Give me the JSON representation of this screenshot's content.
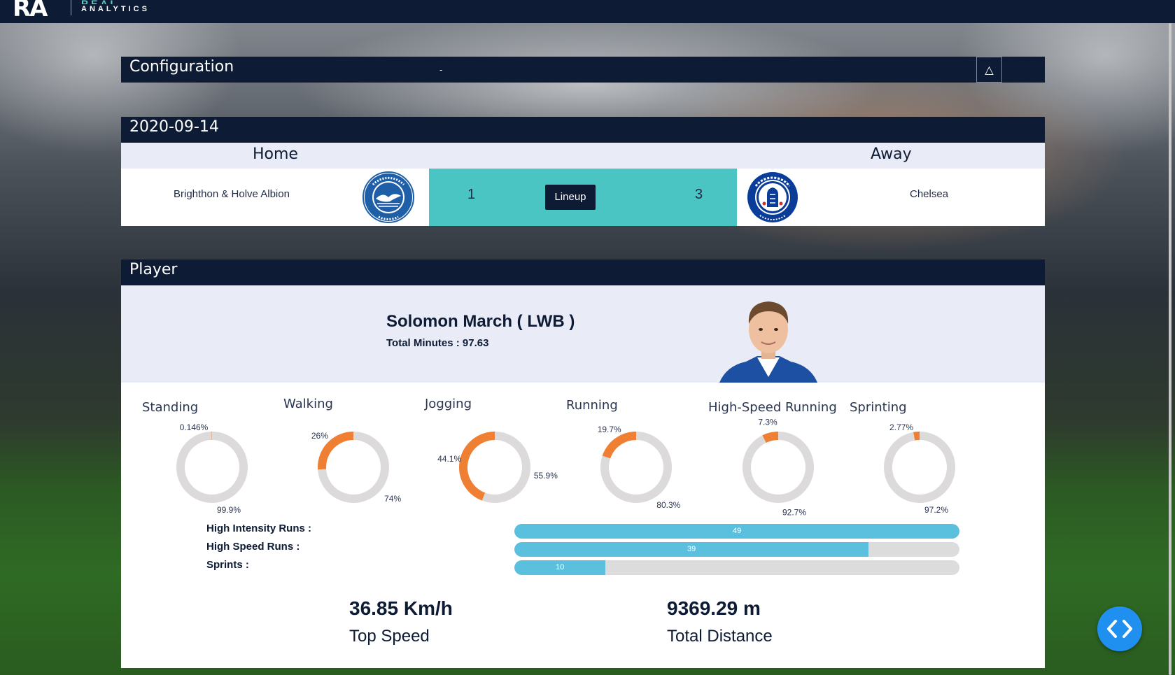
{
  "brand": {
    "mark": "RA",
    "line1": "REAL",
    "line2": "ANALYTICS"
  },
  "config": {
    "title": "Configuration",
    "center_text": "-",
    "collapse_icon": "△"
  },
  "match": {
    "date": "2020-09-14",
    "home_label": "Home",
    "away_label": "Away",
    "home_team": "Brighthon & Holve Albion",
    "away_team": "Chelsea",
    "home_score": "1",
    "away_score": "3",
    "lineup_label": "Lineup",
    "home_crest": "brighton-crest-icon",
    "away_crest": "chelsea-crest-icon"
  },
  "player": {
    "section_title": "Player",
    "name": "Solomon March ( LWB )",
    "minutes": "Total Minutes : 97.63",
    "photo": "player-photo"
  },
  "chart_data": {
    "type": "pie",
    "charts": [
      {
        "title": "Standing",
        "active_pct": 0.146,
        "active_label": "0.146%",
        "rest_label": "99.9%"
      },
      {
        "title": "Walking",
        "active_pct": 26,
        "active_label": "26%",
        "rest_label": "74%"
      },
      {
        "title": "Jogging",
        "active_pct": 44.1,
        "active_label": "44.1%",
        "rest_label": "55.9%"
      },
      {
        "title": "Running",
        "active_pct": 19.7,
        "active_label": "19.7%",
        "rest_label": "80.3%"
      },
      {
        "title": "High-Speed Running",
        "active_pct": 7.3,
        "active_label": "7.3%",
        "rest_label": "92.7%"
      },
      {
        "title": "Sprinting",
        "active_pct": 2.77,
        "active_label": "2.77%",
        "rest_label": "97.2%"
      }
    ],
    "colors": {
      "active": "#ef7f32",
      "rest": "#dcdada"
    },
    "bars": [
      {
        "label": "High Intensity Runs :",
        "value": 49,
        "max": 49
      },
      {
        "label": "High Speed Runs :",
        "value": 39,
        "max": 49
      },
      {
        "label": "Sprints :",
        "value": 10,
        "max": 49
      }
    ]
  },
  "stats": {
    "top_speed_value": "36.85 Km/h",
    "top_speed_label": "Top Speed",
    "distance_value": "9369.29 m",
    "distance_label": "Total Distance"
  },
  "fab_icon": "code-brackets-icon"
}
